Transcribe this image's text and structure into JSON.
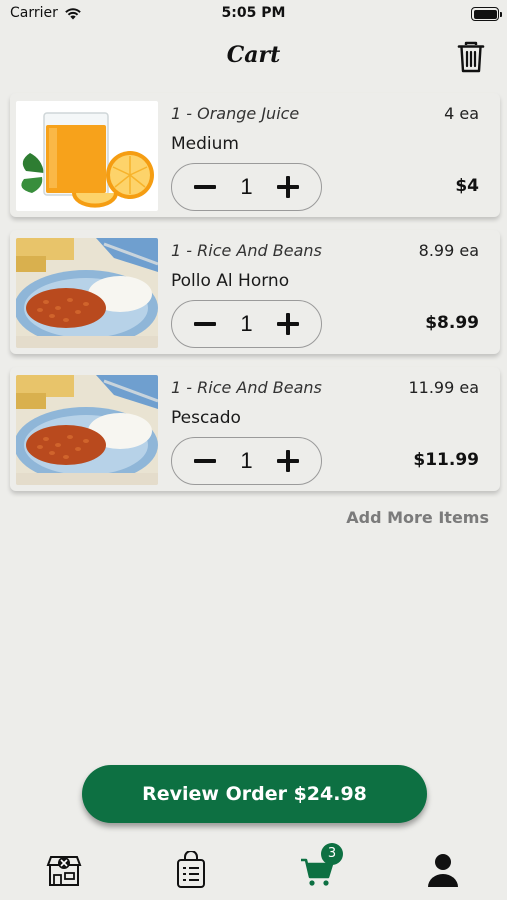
{
  "status_bar": {
    "carrier": "Carrier",
    "time": "5:05 PM"
  },
  "header": {
    "title": "Cart",
    "trash_icon": "trash-icon"
  },
  "cart_items": [
    {
      "title": "1 - Orange Juice",
      "price_each": "4 ea",
      "option": "Medium",
      "quantity": "1",
      "total": "$4",
      "image": "orange-juice"
    },
    {
      "title": "1 - Rice And Beans",
      "price_each": "8.99 ea",
      "option": "Pollo Al Horno",
      "quantity": "1",
      "total": "$8.99",
      "image": "rice-and-beans"
    },
    {
      "title": "1 - Rice And Beans",
      "price_each": "11.99 ea",
      "option": "Pescado",
      "quantity": "1",
      "total": "$11.99",
      "image": "rice-and-beans"
    }
  ],
  "add_more_label": "Add More Items",
  "review_button_label": "Review Order $24.98",
  "tab_bar": {
    "tabs": [
      {
        "name": "restaurant",
        "icon": "store-icon"
      },
      {
        "name": "orders",
        "icon": "clipboard-bag-icon"
      },
      {
        "name": "cart",
        "icon": "cart-icon",
        "active": true
      },
      {
        "name": "profile",
        "icon": "user-icon"
      }
    ],
    "cart_badge": "3"
  },
  "colors": {
    "accent": "#0d7042",
    "background": "#ededea",
    "muted_link": "#7b7b7b"
  }
}
